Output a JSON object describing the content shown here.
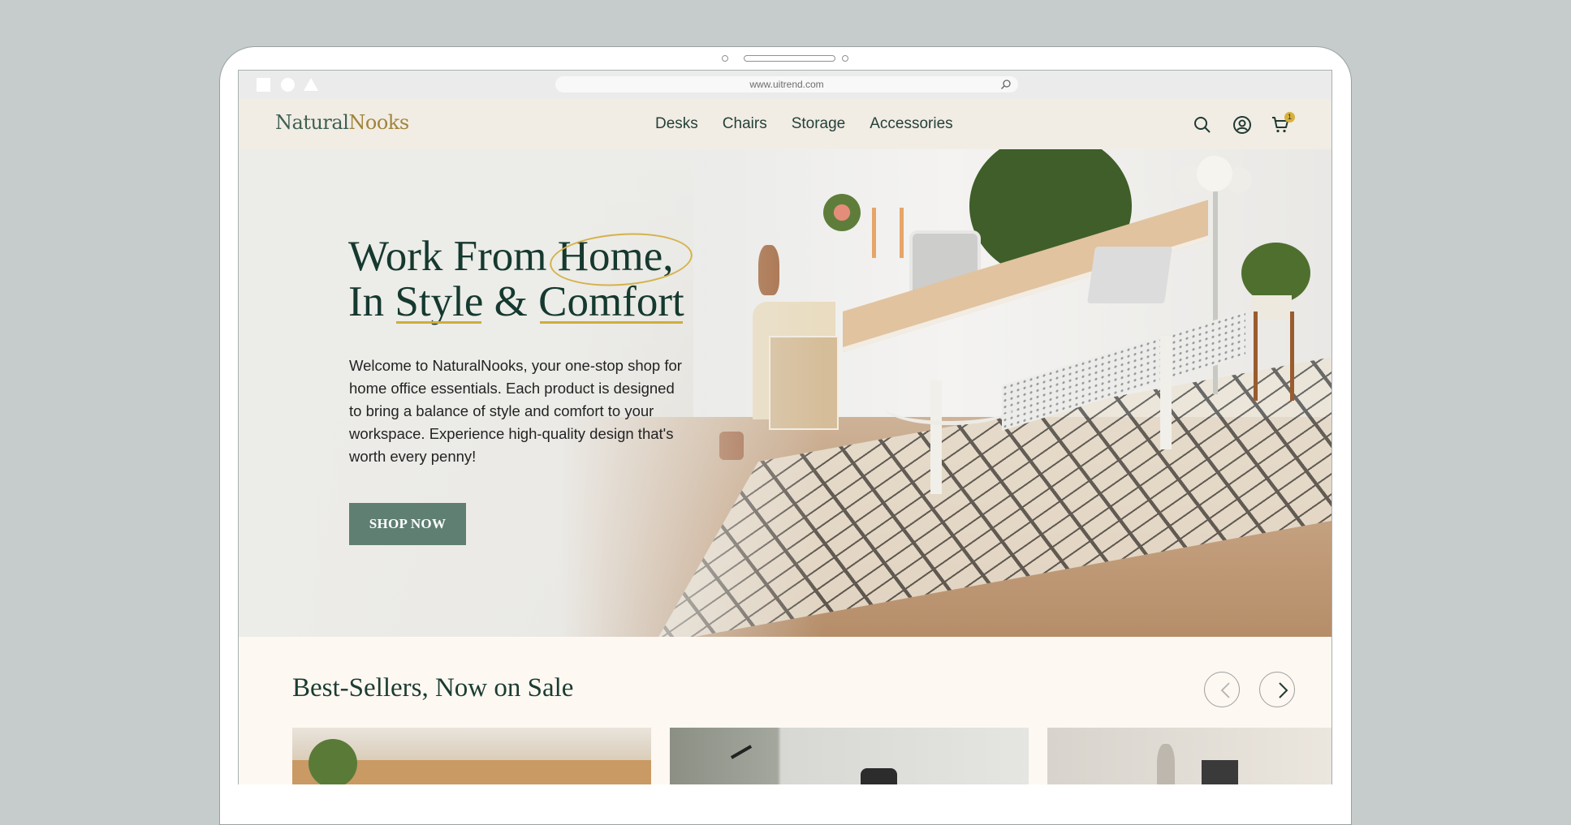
{
  "browser": {
    "url": "www.uitrend.com"
  },
  "brand": {
    "part1": "Natural",
    "part2": "Nooks",
    "colors": {
      "primary": "#3f6153",
      "accent": "#a1843c",
      "highlight": "#d1ac3c",
      "button": "#5f7f73"
    }
  },
  "nav": {
    "items": [
      {
        "label": "Desks"
      },
      {
        "label": "Chairs"
      },
      {
        "label": "Storage"
      },
      {
        "label": "Accessories"
      }
    ]
  },
  "header_icons": {
    "search": "search-icon",
    "account": "user-icon",
    "cart": "cart-icon",
    "cart_count": "1"
  },
  "hero": {
    "headline_line1_a": "Work From ",
    "headline_line1_b": "Home,",
    "headline_line2_a": "In ",
    "headline_line2_b": "Style",
    "headline_line2_c": " & ",
    "headline_line2_d": "Comfort",
    "description": "Welcome to NaturalNooks, your one-stop shop for home office essentials. Each product is designed to bring a balance of style and comfort to your workspace. Experience high-quality design that's worth every penny!",
    "cta": "SHOP NOW"
  },
  "products": {
    "title": "Best-Sellers, Now on Sale",
    "prev_icon": "chevron-left-icon",
    "next_icon": "chevron-right-icon"
  }
}
